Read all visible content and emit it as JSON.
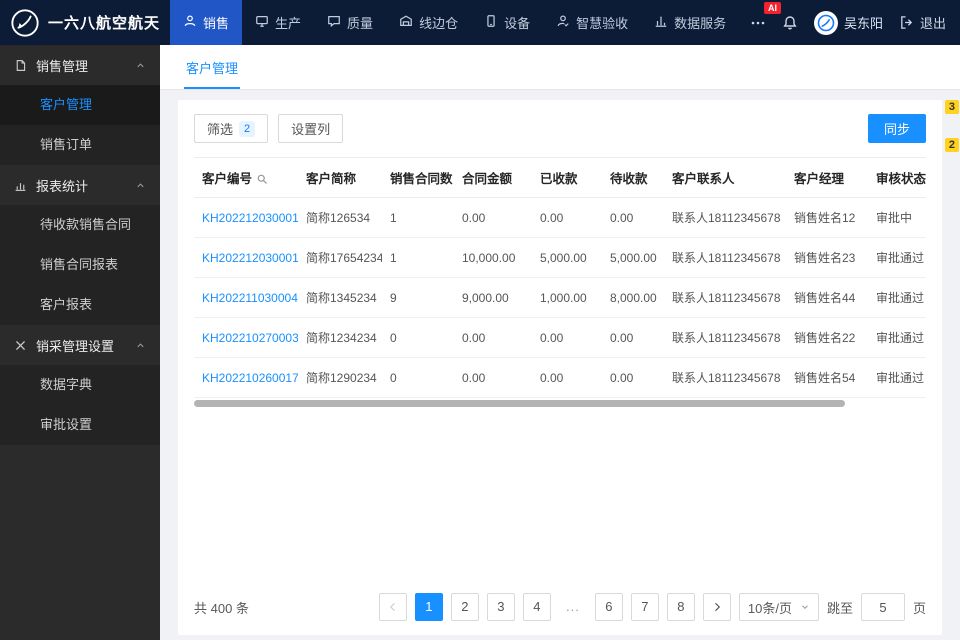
{
  "colors": {
    "primary": "#1890ff",
    "topbar": "#0c1b36",
    "sidebar": "#2b2b2b",
    "marker": "#ffd21e",
    "danger": "#f5222d"
  },
  "topbar": {
    "brand": "一六八航空航天",
    "nav": [
      {
        "label": "销售",
        "icon": "user-icon",
        "active": true
      },
      {
        "label": "生产",
        "icon": "monitor-icon"
      },
      {
        "label": "质量",
        "icon": "chat-icon"
      },
      {
        "label": "线边仓",
        "icon": "warehouse-icon"
      },
      {
        "label": "设备",
        "icon": "device-icon"
      },
      {
        "label": "智慧验收",
        "icon": "inspect-icon"
      },
      {
        "label": "数据服务",
        "icon": "data-icon"
      }
    ],
    "ai_badge": "AI",
    "user_name": "吴东阳",
    "logout_label": "退出"
  },
  "sidebar": {
    "groups": [
      {
        "label": "销售管理",
        "icon": "file-icon",
        "items": [
          {
            "label": "客户管理",
            "active": true
          },
          {
            "label": "销售订单"
          }
        ]
      },
      {
        "label": "报表统计",
        "icon": "chart-icon",
        "items": [
          {
            "label": "待收款销售合同"
          },
          {
            "label": "销售合同报表"
          },
          {
            "label": "客户报表"
          }
        ]
      },
      {
        "label": "销采管理设置",
        "icon": "tools-icon",
        "items": [
          {
            "label": "数据字典"
          },
          {
            "label": "审批设置"
          }
        ]
      }
    ]
  },
  "tabs": [
    {
      "label": "客户管理",
      "active": true
    }
  ],
  "toolbar": {
    "filter_label": "筛选",
    "filter_badge": "2",
    "columns_label": "设置列",
    "sync_label": "同步"
  },
  "markers": {
    "top": "3",
    "bottom": "2"
  },
  "table": {
    "headers": [
      {
        "label": "客户编号",
        "icon": "search-icon"
      },
      {
        "label": "客户简称"
      },
      {
        "label": "销售合同数"
      },
      {
        "label": "合同金额"
      },
      {
        "label": "已收款"
      },
      {
        "label": "待收款"
      },
      {
        "label": "客户联系人"
      },
      {
        "label": "客户经理"
      },
      {
        "label": "审核状态"
      }
    ],
    "rows": [
      {
        "id": "KH202212030001",
        "short": "简称126534",
        "count": "1",
        "amount": "0.00",
        "received": "0.00",
        "pending": "0.00",
        "contact": "联系人18112345678",
        "manager": "销售姓名12",
        "status": "审批中"
      },
      {
        "id": "KH202212030001",
        "short": "简称17654234",
        "count": "1",
        "amount": "10,000.00",
        "received": "5,000.00",
        "pending": "5,000.00",
        "contact": "联系人18112345678",
        "manager": "销售姓名23",
        "status": "审批通过"
      },
      {
        "id": "KH202211030004",
        "short": "简称1345234",
        "count": "9",
        "amount": "9,000.00",
        "received": "1,000.00",
        "pending": "8,000.00",
        "contact": "联系人18112345678",
        "manager": "销售姓名44",
        "status": "审批通过"
      },
      {
        "id": "KH202210270003",
        "short": "简称1234234",
        "count": "0",
        "amount": "0.00",
        "received": "0.00",
        "pending": "0.00",
        "contact": "联系人18112345678",
        "manager": "销售姓名22",
        "status": "审批通过"
      },
      {
        "id": "KH202210260017",
        "short": "简称1290234",
        "count": "0",
        "amount": "0.00",
        "received": "0.00",
        "pending": "0.00",
        "contact": "联系人18112345678",
        "manager": "销售姓名54",
        "status": "审批通过"
      }
    ]
  },
  "pagination": {
    "total": "共 400 条",
    "pages": [
      {
        "label": "1",
        "active": true
      },
      {
        "label": "2"
      },
      {
        "label": "3"
      },
      {
        "label": "4"
      },
      {
        "label": "...",
        "ellipsis": true
      },
      {
        "label": "6"
      },
      {
        "label": "7"
      },
      {
        "label": "8"
      }
    ],
    "page_size": "10条/页",
    "jump_label": "跳至",
    "jump_value": "5",
    "page_unit": "页"
  }
}
